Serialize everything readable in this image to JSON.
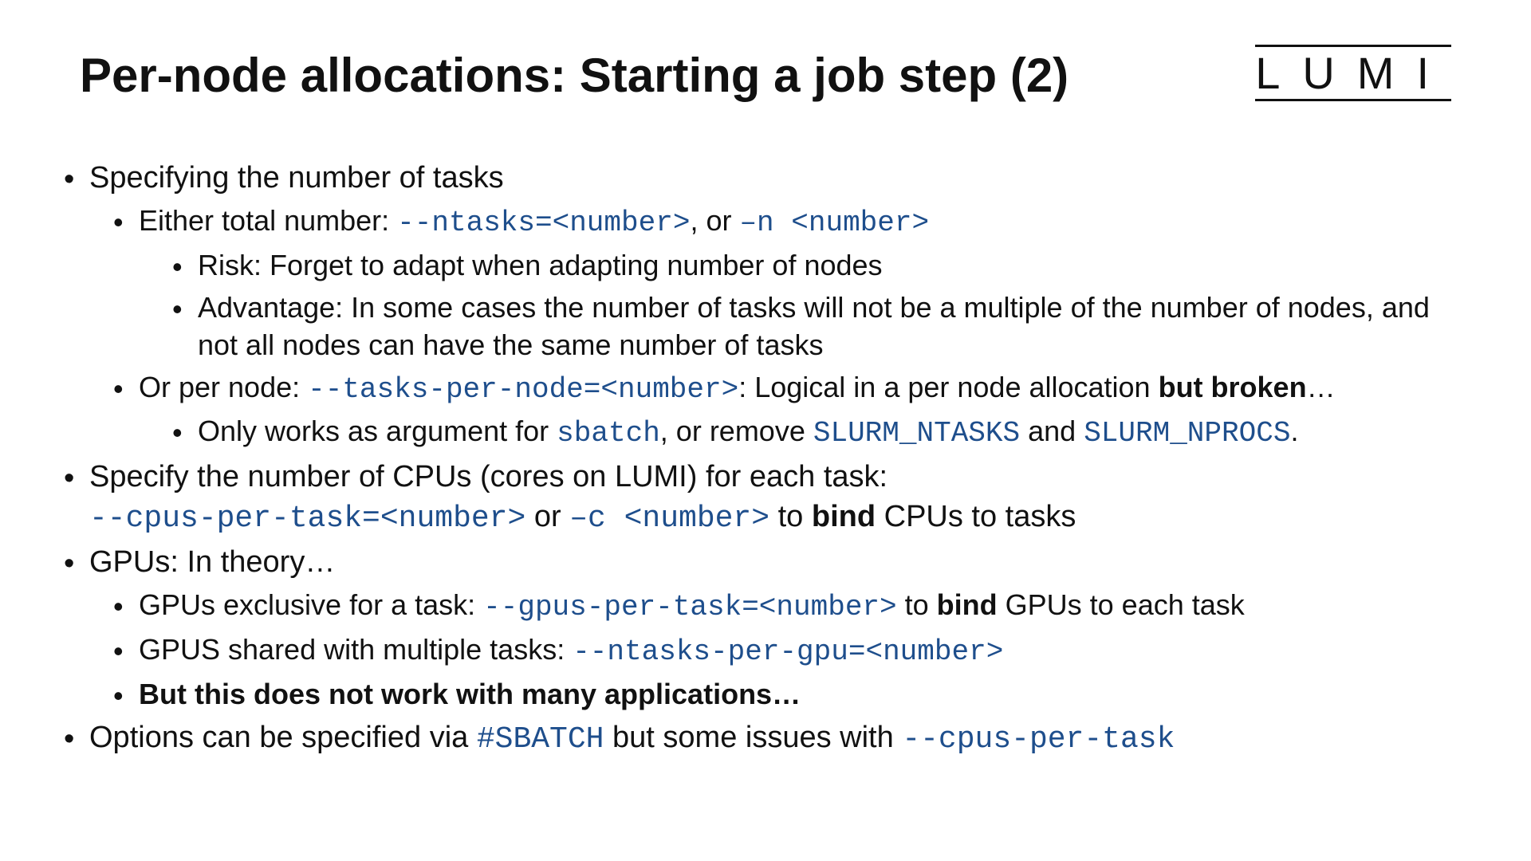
{
  "logo": "LUMI",
  "title": "Per-node allocations: Starting a job step (2)",
  "b1": {
    "text": "Specifying the number of tasks",
    "b1": {
      "pre": "Either total number: ",
      "code1": "--ntasks=<number>",
      "mid": ", or ",
      "code2": "–n <number>",
      "s1": "Risk: Forget to adapt when adapting number of nodes",
      "s2": "Advantage: In some cases the number of tasks will not be a multiple of the number of nodes, and not all nodes can have the same number of tasks"
    },
    "b2": {
      "pre": "Or per node: ",
      "code1": "--tasks-per-node=<number>",
      "mid": ": Logical in a per node allocation ",
      "bold": "but broken",
      "post": "…",
      "s1": {
        "pre": "Only works as argument for ",
        "code1": "sbatch",
        "mid": ", or remove ",
        "code2": "SLURM_NTASKS",
        "and": " and ",
        "code3": "SLURM_NPROCS",
        "post": "."
      }
    }
  },
  "b2": {
    "line1": "Specify the number of CPUs (cores on LUMI) for each task:",
    "code1": "--cpus-per-task=<number>",
    "mid": " or ",
    "code2": "–c <number>",
    "mid2": " to ",
    "bold": "bind",
    "post": " CPUs to tasks"
  },
  "b3": {
    "text": "GPUs: In theory…",
    "s1": {
      "pre": "GPUs exclusive for a task: ",
      "code1": "--gpus-per-task=<number>",
      "mid": " to ",
      "bold": "bind",
      "post": " GPUs to each task"
    },
    "s2": {
      "pre": "GPUS shared with multiple tasks: ",
      "code1": "--ntasks-per-gpu=<number>"
    },
    "s3": "But this does not work with many applications…"
  },
  "b4": {
    "pre": "Options can be specified via ",
    "code1": "#SBATCH",
    "mid": " but some issues with ",
    "code2": "--cpus-per-task"
  }
}
